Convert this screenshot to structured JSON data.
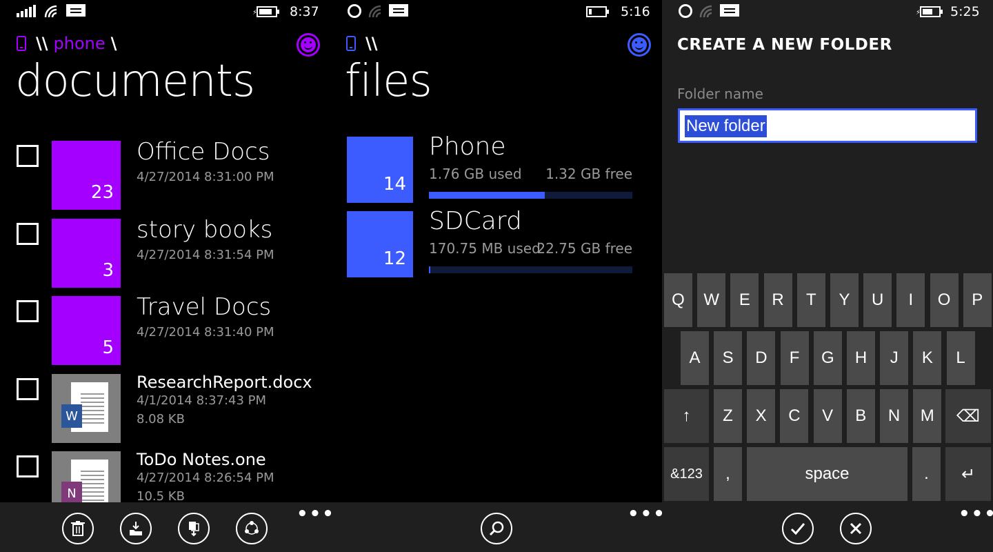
{
  "screens": {
    "documents": {
      "status": {
        "time": "8:37"
      },
      "breadcrumb": {
        "separator": "\\\\",
        "segment": "phone",
        "trail": "\\"
      },
      "title": "documents",
      "accent": "#a300ff",
      "rows": [
        {
          "title": "Office Docs",
          "date": "4/27/2014 8:31:00 PM",
          "count": "23",
          "kind": "folder"
        },
        {
          "title": "story books",
          "date": "4/27/2014 8:31:54 PM",
          "count": "3",
          "kind": "folder"
        },
        {
          "title": "Travel Docs",
          "date": "4/27/2014 8:31:40 PM",
          "count": "5",
          "kind": "folder"
        },
        {
          "title": "ResearchReport.docx",
          "date": "4/1/2014 8:37:43 PM",
          "size": "8.08 KB",
          "kind": "word",
          "badge": "W"
        },
        {
          "title": "ToDo Notes.one",
          "date": "4/27/2014 8:26:54 PM",
          "size": "10.5 KB",
          "kind": "onenote",
          "badge": "N"
        }
      ],
      "appbar": {
        "icons": [
          "delete-icon",
          "move-to-folder-icon",
          "copy-icon",
          "share-icon"
        ],
        "more": "•••"
      }
    },
    "files": {
      "status": {
        "time": "5:16"
      },
      "breadcrumb": {
        "separator": "\\\\"
      },
      "title": "files",
      "accent": "#3d5cff",
      "storage": [
        {
          "name": "Phone",
          "count": "14",
          "used": "1.76 GB used",
          "free": "1.32 GB free",
          "used_fraction": 0.57
        },
        {
          "name": "SDCard",
          "count": "12",
          "used": "170.75 MB used",
          "free": "22.75 GB free",
          "used_fraction": 0.007
        }
      ],
      "appbar": {
        "icons": [
          "search-icon"
        ],
        "more": "•••"
      }
    },
    "create_folder": {
      "status": {
        "time": "5:25"
      },
      "title": "CREATE A NEW FOLDER",
      "field_label": "Folder name",
      "field_value": "New folder",
      "keyboard": {
        "row1": [
          "Q",
          "W",
          "E",
          "R",
          "T",
          "Y",
          "U",
          "I",
          "O",
          "P"
        ],
        "row2": [
          "A",
          "S",
          "D",
          "F",
          "G",
          "H",
          "J",
          "K",
          "L"
        ],
        "row3": [
          "↑",
          "Z",
          "X",
          "C",
          "V",
          "B",
          "N",
          "M",
          "⌫"
        ],
        "row4": [
          "&123",
          ",",
          "space",
          ".",
          "↵"
        ]
      },
      "appbar": {
        "icons": [
          "check-icon",
          "cancel-icon"
        ],
        "more": "•••"
      }
    }
  }
}
